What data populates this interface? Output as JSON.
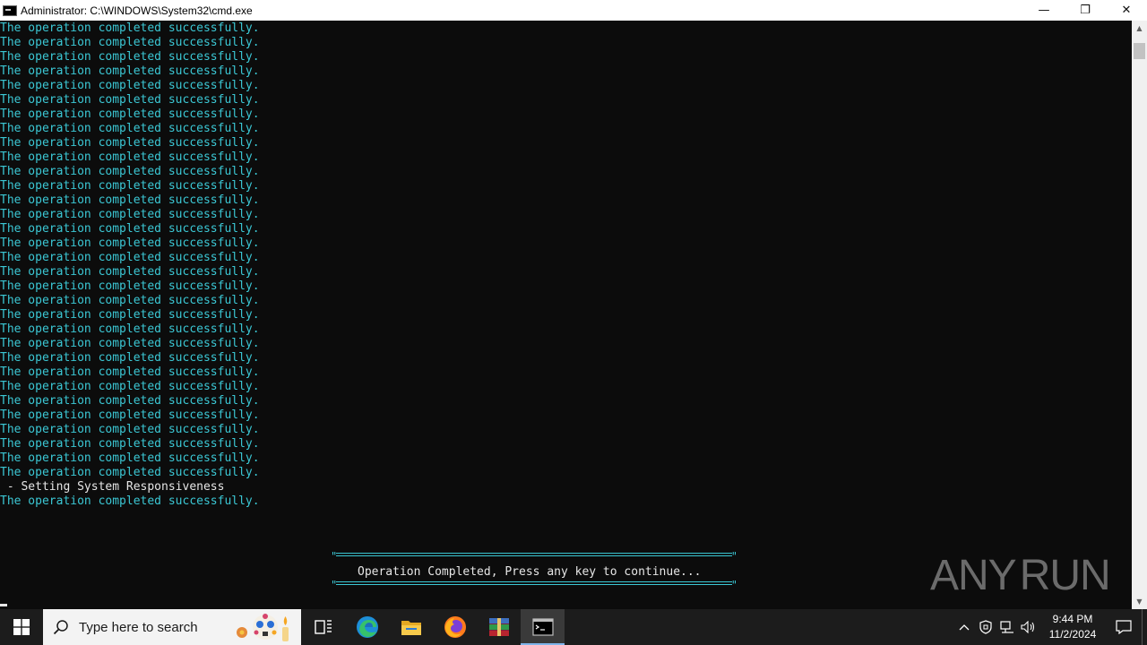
{
  "window": {
    "title": "Administrator: C:\\WINDOWS\\System32\\cmd.exe",
    "minimize_glyph": "—",
    "restore_glyph": "❐",
    "close_glyph": "✕"
  },
  "console": {
    "lines": [
      {
        "text": "The operation completed successfully.",
        "kind": "ok"
      },
      {
        "text": "The operation completed successfully.",
        "kind": "ok"
      },
      {
        "text": "The operation completed successfully.",
        "kind": "ok"
      },
      {
        "text": "The operation completed successfully.",
        "kind": "ok"
      },
      {
        "text": "The operation completed successfully.",
        "kind": "ok"
      },
      {
        "text": "The operation completed successfully.",
        "kind": "ok"
      },
      {
        "text": "The operation completed successfully.",
        "kind": "ok"
      },
      {
        "text": "The operation completed successfully.",
        "kind": "ok"
      },
      {
        "text": "The operation completed successfully.",
        "kind": "ok"
      },
      {
        "text": "The operation completed successfully.",
        "kind": "ok"
      },
      {
        "text": "The operation completed successfully.",
        "kind": "ok"
      },
      {
        "text": "The operation completed successfully.",
        "kind": "ok"
      },
      {
        "text": "The operation completed successfully.",
        "kind": "ok"
      },
      {
        "text": "The operation completed successfully.",
        "kind": "ok"
      },
      {
        "text": "The operation completed successfully.",
        "kind": "ok"
      },
      {
        "text": "The operation completed successfully.",
        "kind": "ok"
      },
      {
        "text": "The operation completed successfully.",
        "kind": "ok"
      },
      {
        "text": "The operation completed successfully.",
        "kind": "ok"
      },
      {
        "text": "The operation completed successfully.",
        "kind": "ok"
      },
      {
        "text": "The operation completed successfully.",
        "kind": "ok"
      },
      {
        "text": "The operation completed successfully.",
        "kind": "ok"
      },
      {
        "text": "The operation completed successfully.",
        "kind": "ok"
      },
      {
        "text": "The operation completed successfully.",
        "kind": "ok"
      },
      {
        "text": "The operation completed successfully.",
        "kind": "ok"
      },
      {
        "text": "The operation completed successfully.",
        "kind": "ok"
      },
      {
        "text": "The operation completed successfully.",
        "kind": "ok"
      },
      {
        "text": "The operation completed successfully.",
        "kind": "ok"
      },
      {
        "text": "The operation completed successfully.",
        "kind": "ok"
      },
      {
        "text": "The operation completed successfully.",
        "kind": "ok"
      },
      {
        "text": "The operation completed successfully.",
        "kind": "ok"
      },
      {
        "text": "The operation completed successfully.",
        "kind": "ok"
      },
      {
        "text": "The operation completed successfully.",
        "kind": "ok"
      },
      {
        "text": " - Setting System Responsiveness",
        "kind": "info"
      },
      {
        "text": "The operation completed successfully.",
        "kind": "ok"
      }
    ],
    "banner_text": "Operation Completed, Press any key to continue...",
    "banner_quote": "\""
  },
  "watermark": {
    "left": "ANY",
    "right": "RUN"
  },
  "taskbar": {
    "search_placeholder": "Type here to search",
    "apps": [
      {
        "name": "task-view-icon",
        "active": false
      },
      {
        "name": "edge-icon",
        "active": false
      },
      {
        "name": "file-explorer-icon",
        "active": false
      },
      {
        "name": "firefox-icon",
        "active": false
      },
      {
        "name": "winrar-icon",
        "active": false
      },
      {
        "name": "cmd-icon",
        "active": true
      }
    ],
    "tray": {
      "chevron": "^",
      "time": "9:44 PM",
      "date": "11/2/2024"
    }
  },
  "colors": {
    "console_ok": "#3bc7d4",
    "console_info": "#e6e6e6",
    "console_bg": "#0c0c0c",
    "taskbar_bg": "#1c1c1c"
  }
}
